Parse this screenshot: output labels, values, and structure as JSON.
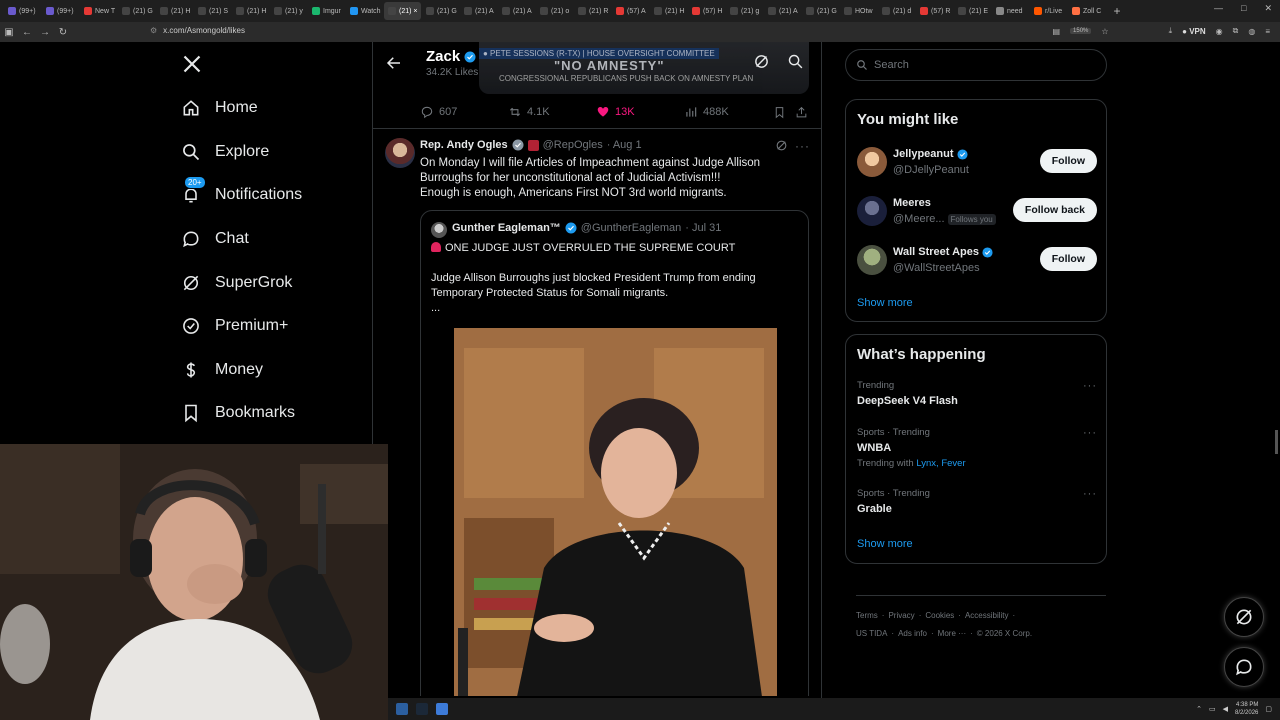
{
  "browser": {
    "tabs": [
      {
        "label": "(99+)",
        "color": "#6a5acd"
      },
      {
        "label": "(99+)",
        "color": "#6a5acd"
      },
      {
        "label": "New T",
        "color": "#e53935"
      },
      {
        "label": "(21) G",
        "color": "#444"
      },
      {
        "label": "(21) H",
        "color": "#444"
      },
      {
        "label": "(21) S",
        "color": "#444"
      },
      {
        "label": "(21) H",
        "color": "#444"
      },
      {
        "label": "(21) y",
        "color": "#444"
      },
      {
        "label": "Imgur",
        "color": "#1bb76e"
      },
      {
        "label": "Watch",
        "color": "#2196f3"
      },
      {
        "label": "(21) ×",
        "color": "#444",
        "active": true
      },
      {
        "label": "(21) G",
        "color": "#444"
      },
      {
        "label": "(21) A",
        "color": "#444"
      },
      {
        "label": "(21) A",
        "color": "#444"
      },
      {
        "label": "(21) o",
        "color": "#444"
      },
      {
        "label": "(21) R",
        "color": "#444"
      },
      {
        "label": "(57) A",
        "color": "#e53935"
      },
      {
        "label": "(21) H",
        "color": "#444"
      },
      {
        "label": "(57) H",
        "color": "#e53935"
      },
      {
        "label": "(21) g",
        "color": "#444"
      },
      {
        "label": "(21) A",
        "color": "#444"
      },
      {
        "label": "(21) G",
        "color": "#444"
      },
      {
        "label": "HOtw",
        "color": "#444"
      },
      {
        "label": "(21) d",
        "color": "#444"
      },
      {
        "label": "(57) R",
        "color": "#e53935"
      },
      {
        "label": "(21) E",
        "color": "#444"
      },
      {
        "label": "need",
        "color": "#888"
      },
      {
        "label": "r/Live",
        "color": "#ff5700"
      },
      {
        "label": "Zoll C",
        "color": "#ff7043"
      }
    ],
    "new_tab": "+",
    "url": "x.com/Asmongold/likes",
    "zoom": "150%",
    "vpn_label": "VPN"
  },
  "nav": {
    "items": [
      {
        "label": "Home",
        "icon": "home-icon"
      },
      {
        "label": "Explore",
        "icon": "search-icon"
      },
      {
        "label": "Notifications",
        "icon": "bell-icon",
        "badge": "20+"
      },
      {
        "label": "Chat",
        "icon": "chat-icon"
      },
      {
        "label": "SuperGrok",
        "icon": "grok-icon"
      },
      {
        "label": "Premium+",
        "icon": "premium-icon"
      },
      {
        "label": "Money",
        "icon": "money-icon"
      },
      {
        "label": "Bookmarks",
        "icon": "bookmark-icon"
      }
    ]
  },
  "header": {
    "name": "Zack",
    "subtitle": "34.2K Likes",
    "media_ticker": "● PETE SESSIONS (R-TX) | HOUSE OVERSIGHT COMMITTEE",
    "media_quote": "\"NO AMNESTY\"",
    "media_caption": "CONGRESSIONAL REPUBLICANS PUSH BACK ON AMNESTY PLAN"
  },
  "prev_tweet_actions": {
    "replies": "607",
    "reposts": "4.1K",
    "likes": "13K",
    "views": "488K"
  },
  "tweet": {
    "display_name": "Rep. Andy Ogles",
    "handle": "@RepOgles",
    "date": "· Aug 1",
    "text_lines": [
      "On Monday I will file Articles of Impeachment against Judge Allison",
      "Burroughs for her unconstitutional act of Judicial Activism!!!",
      "Enough is enough, Americans First NOT 3rd world migrants."
    ],
    "quote": {
      "display_name": "Gunther Eagleman™",
      "handle": "@GuntherEagleman",
      "date": "· Jul 31",
      "headline": "ONE JUDGE JUST OVERRULED THE SUPREME COURT",
      "body_lines": [
        "Judge Allison Burroughs just blocked President Trump from ending",
        "Temporary Protected Status for Somali migrants."
      ],
      "ellipsis": "..."
    }
  },
  "right": {
    "search_placeholder": "Search",
    "you_might_like": {
      "title": "You might like",
      "suggestions": [
        {
          "name": "Jellypeanut",
          "handle": "@DJellyPeanut",
          "verified": true,
          "button": "Follow",
          "follows_you": ""
        },
        {
          "name": "Meeres",
          "handle": "@Meere...",
          "verified": false,
          "button": "Follow back",
          "follows_you": "Follows you"
        },
        {
          "name": "Wall Street Apes",
          "handle": "@WallStreetApes",
          "verified": true,
          "button": "Follow",
          "follows_you": ""
        }
      ],
      "show_more": "Show more"
    },
    "whats_happening": {
      "title": "What’s happening",
      "trends": [
        {
          "context": "Trending",
          "name": "DeepSeek V4 Flash",
          "with_label": "",
          "with_links": ""
        },
        {
          "context": "Sports · Trending",
          "name": "WNBA",
          "with_label": "Trending with",
          "with_links": "Lynx, Fever"
        },
        {
          "context": "Sports · Trending",
          "name": "Grable",
          "with_label": "",
          "with_links": ""
        }
      ],
      "show_more": "Show more"
    },
    "footer": {
      "line1": [
        "Terms",
        "·",
        "Privacy",
        "·",
        "Cookies",
        "·",
        "Accessibility",
        "·"
      ],
      "line2": [
        "US TIDA",
        "·",
        "Ads info",
        "·",
        "More ···",
        "·",
        "© 2026 X Corp."
      ]
    }
  },
  "taskbar": {
    "time": "4:38 PM",
    "date": "8/2/2026"
  },
  "colors": {
    "accent": "#1d9bf0",
    "like": "#f91880",
    "background": "#000000",
    "border": "#2f3336",
    "muted": "#71767b"
  }
}
